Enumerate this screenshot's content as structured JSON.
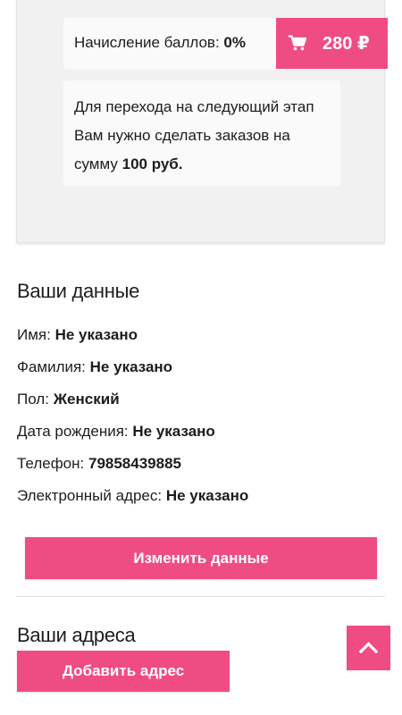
{
  "loyalty": {
    "points_label": "Начисление баллов:",
    "points_value": "0%",
    "next_stage_text": "Для перехода на следующий этап Вам нужно сделать заказов на сумму",
    "next_stage_amount": "100 руб."
  },
  "cart": {
    "icon": "cart-icon",
    "total": "280 ₽"
  },
  "profile": {
    "title": "Ваши данные",
    "rows": [
      {
        "label": "Имя:",
        "value": "Не указано"
      },
      {
        "label": "Фамилия:",
        "value": "Не указано"
      },
      {
        "label": "Пол:",
        "value": "Женский"
      },
      {
        "label": "Дата рождения:",
        "value": "Не указано"
      },
      {
        "label": "Телефон:",
        "value": "79858439885"
      },
      {
        "label": "Электронный адрес:",
        "value": "Не указано"
      }
    ],
    "edit_button": "Изменить данные"
  },
  "addresses": {
    "title": "Ваши адреса",
    "add_button": "Добавить адрес"
  },
  "scroll_top": {
    "icon": "chevron-up-icon"
  },
  "colors": {
    "accent": "#ef4c84",
    "card_background": "#f1f1f1",
    "text": "#1d1d1d"
  }
}
